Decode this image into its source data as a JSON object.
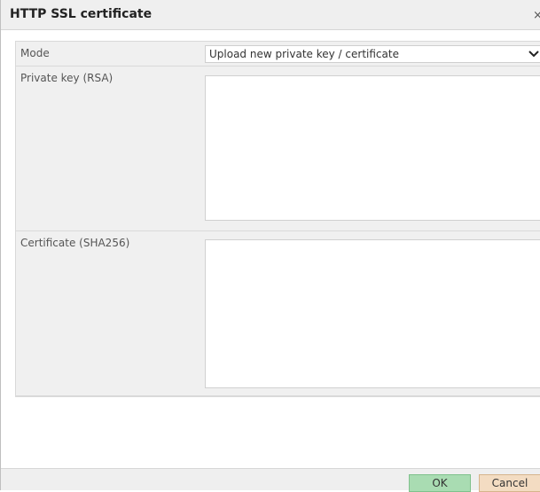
{
  "dialog": {
    "title": "HTTP SSL certificate",
    "close_glyph": "×"
  },
  "form": {
    "mode": {
      "label": "Mode",
      "selected": "Upload new private key / certificate"
    },
    "private_key": {
      "label": "Private key (RSA)",
      "value": ""
    },
    "certificate": {
      "label": "Certificate (SHA256)",
      "value": ""
    }
  },
  "footer": {
    "ok_label": "OK",
    "cancel_label": "Cancel"
  },
  "colors": {
    "ok_button": "#a9dcb2",
    "cancel_button": "#f3dcc2",
    "row_background": "#f0f0f0"
  }
}
